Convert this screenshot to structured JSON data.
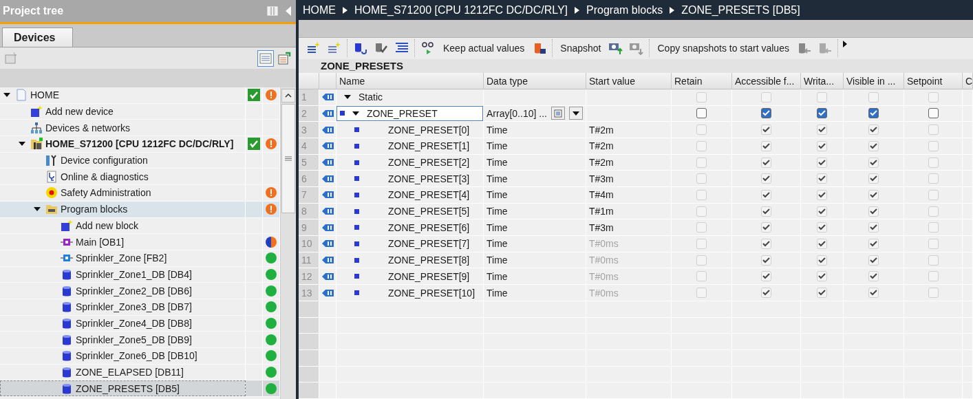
{
  "project_tree": {
    "title": "Project tree",
    "tabs": [
      {
        "label": "Devices",
        "selected": true
      }
    ],
    "items": [
      {
        "label": "HOME",
        "kind": "project",
        "expanded": true,
        "check": true,
        "status": {
          "kind": "warning"
        },
        "selected": false,
        "highlighted": false,
        "children": [
          {
            "label": "Add new device",
            "kind": "add-device",
            "check": false,
            "selected": false,
            "highlighted": false
          },
          {
            "label": "Devices & networks",
            "kind": "network",
            "check": false,
            "selected": false,
            "highlighted": false
          },
          {
            "label": "HOME_S71200 [CPU 1212FC DC/DC/RLY]",
            "kind": "plc",
            "expanded": true,
            "check": true,
            "status": {
              "kind": "warning"
            },
            "selected": false,
            "highlighted": false,
            "children": [
              {
                "label": "Device configuration",
                "kind": "device-config",
                "check": false,
                "selected": false,
                "highlighted": false
              },
              {
                "label": "Online & diagnostics",
                "kind": "diagnostics",
                "check": false,
                "selected": false,
                "highlighted": false
              },
              {
                "label": "Safety Administration",
                "kind": "safety",
                "check": false,
                "status": {
                  "kind": "warning"
                },
                "selected": false,
                "highlighted": false
              },
              {
                "label": "Program blocks",
                "kind": "folder",
                "expanded": true,
                "check": false,
                "status": {
                  "kind": "warning"
                },
                "selected": false,
                "highlighted": true,
                "children": [
                  {
                    "label": "Add new block",
                    "kind": "add-block",
                    "check": false,
                    "selected": false,
                    "highlighted": false
                  },
                  {
                    "label": "Main [OB1]",
                    "kind": "ob",
                    "check": false,
                    "status": {
                      "kind": "mixed"
                    },
                    "selected": false,
                    "highlighted": false
                  },
                  {
                    "label": "Sprinkler_Zone [FB2]",
                    "kind": "fb",
                    "check": false,
                    "status": {
                      "kind": "ok"
                    },
                    "selected": false,
                    "highlighted": false
                  },
                  {
                    "label": "Sprinkler_Zone1_DB [DB4]",
                    "kind": "db",
                    "check": false,
                    "status": {
                      "kind": "ok"
                    },
                    "selected": false,
                    "highlighted": false
                  },
                  {
                    "label": "Sprinkler_Zone2_DB [DB6]",
                    "kind": "db",
                    "check": false,
                    "status": {
                      "kind": "ok"
                    },
                    "selected": false,
                    "highlighted": false
                  },
                  {
                    "label": "Sprinkler_Zone3_DB [DB7]",
                    "kind": "db",
                    "check": false,
                    "status": {
                      "kind": "ok"
                    },
                    "selected": false,
                    "highlighted": false
                  },
                  {
                    "label": "Sprinkler_Zone4_DB [DB8]",
                    "kind": "db",
                    "check": false,
                    "status": {
                      "kind": "ok"
                    },
                    "selected": false,
                    "highlighted": false
                  },
                  {
                    "label": "Sprinkler_Zone5_DB [DB9]",
                    "kind": "db",
                    "check": false,
                    "status": {
                      "kind": "ok"
                    },
                    "selected": false,
                    "highlighted": false
                  },
                  {
                    "label": "Sprinkler_Zone6_DB [DB10]",
                    "kind": "db",
                    "check": false,
                    "status": {
                      "kind": "ok"
                    },
                    "selected": false,
                    "highlighted": false
                  },
                  {
                    "label": "ZONE_ELAPSED [DB11]",
                    "kind": "db",
                    "check": false,
                    "status": {
                      "kind": "ok"
                    },
                    "selected": false,
                    "highlighted": false
                  },
                  {
                    "label": "ZONE_PRESETS [DB5]",
                    "kind": "db",
                    "check": false,
                    "status": {
                      "kind": "ok"
                    },
                    "selected": true,
                    "highlighted": false
                  }
                ]
              }
            ]
          }
        ]
      }
    ]
  },
  "breadcrumb": [
    "HOME",
    "HOME_S71200 [CPU 1212FC DC/DC/RLY]",
    "Program blocks",
    "ZONE_PRESETS [DB5]"
  ],
  "toolbar": {
    "keep_label": "Keep actual values",
    "snapshot_label": "Snapshot",
    "copy_label": "Copy snapshots to start values"
  },
  "block_title": "ZONE_PRESETS",
  "table": {
    "columns": [
      "Name",
      "Data type",
      "Start value",
      "Retain",
      "Accessible f...",
      "Writa...",
      "Visible in ...",
      "Setpoint",
      "C"
    ],
    "rows": [
      {
        "num": "1",
        "kind": "section",
        "name": "Static",
        "expanded": true,
        "data_type": "",
        "start_value": "",
        "default": false,
        "selected": false,
        "flags": [
          {
            "checked": false,
            "disabled": true
          },
          {
            "checked": false,
            "disabled": true
          },
          {
            "checked": false,
            "disabled": true
          },
          {
            "checked": false,
            "disabled": true
          },
          {
            "checked": false,
            "disabled": true
          }
        ]
      },
      {
        "num": "2",
        "kind": "array",
        "name": "ZONE_PRESET",
        "expanded": true,
        "data_type": "Array[0..10] ...",
        "start_value": "",
        "default": false,
        "selected": true,
        "flags": [
          {
            "checked": false,
            "disabled": false
          },
          {
            "checked": true,
            "disabled": false
          },
          {
            "checked": true,
            "disabled": false
          },
          {
            "checked": true,
            "disabled": false
          },
          {
            "checked": false,
            "disabled": false
          }
        ]
      },
      {
        "num": "3",
        "kind": "element",
        "name": "ZONE_PRESET[0]",
        "data_type": "Time",
        "start_value": "T#2m",
        "default": false,
        "selected": false,
        "flags": [
          {
            "checked": false,
            "disabled": true
          },
          {
            "checked": true,
            "disabled": true
          },
          {
            "checked": true,
            "disabled": true
          },
          {
            "checked": true,
            "disabled": true
          },
          {
            "checked": false,
            "disabled": true
          }
        ]
      },
      {
        "num": "4",
        "kind": "element",
        "name": "ZONE_PRESET[1]",
        "data_type": "Time",
        "start_value": "T#2m",
        "default": false,
        "selected": false,
        "flags": [
          {
            "checked": false,
            "disabled": true
          },
          {
            "checked": true,
            "disabled": true
          },
          {
            "checked": true,
            "disabled": true
          },
          {
            "checked": true,
            "disabled": true
          },
          {
            "checked": false,
            "disabled": true
          }
        ]
      },
      {
        "num": "5",
        "kind": "element",
        "name": "ZONE_PRESET[2]",
        "data_type": "Time",
        "start_value": "T#2m",
        "default": false,
        "selected": false,
        "flags": [
          {
            "checked": false,
            "disabled": true
          },
          {
            "checked": true,
            "disabled": true
          },
          {
            "checked": true,
            "disabled": true
          },
          {
            "checked": true,
            "disabled": true
          },
          {
            "checked": false,
            "disabled": true
          }
        ]
      },
      {
        "num": "6",
        "kind": "element",
        "name": "ZONE_PRESET[3]",
        "data_type": "Time",
        "start_value": "T#3m",
        "default": false,
        "selected": false,
        "flags": [
          {
            "checked": false,
            "disabled": true
          },
          {
            "checked": true,
            "disabled": true
          },
          {
            "checked": true,
            "disabled": true
          },
          {
            "checked": true,
            "disabled": true
          },
          {
            "checked": false,
            "disabled": true
          }
        ]
      },
      {
        "num": "7",
        "kind": "element",
        "name": "ZONE_PRESET[4]",
        "data_type": "Time",
        "start_value": "T#4m",
        "default": false,
        "selected": false,
        "flags": [
          {
            "checked": false,
            "disabled": true
          },
          {
            "checked": true,
            "disabled": true
          },
          {
            "checked": true,
            "disabled": true
          },
          {
            "checked": true,
            "disabled": true
          },
          {
            "checked": false,
            "disabled": true
          }
        ]
      },
      {
        "num": "8",
        "kind": "element",
        "name": "ZONE_PRESET[5]",
        "data_type": "Time",
        "start_value": "T#1m",
        "default": false,
        "selected": false,
        "flags": [
          {
            "checked": false,
            "disabled": true
          },
          {
            "checked": true,
            "disabled": true
          },
          {
            "checked": true,
            "disabled": true
          },
          {
            "checked": true,
            "disabled": true
          },
          {
            "checked": false,
            "disabled": true
          }
        ]
      },
      {
        "num": "9",
        "kind": "element",
        "name": "ZONE_PRESET[6]",
        "data_type": "Time",
        "start_value": "T#3m",
        "default": false,
        "selected": false,
        "flags": [
          {
            "checked": false,
            "disabled": true
          },
          {
            "checked": true,
            "disabled": true
          },
          {
            "checked": true,
            "disabled": true
          },
          {
            "checked": true,
            "disabled": true
          },
          {
            "checked": false,
            "disabled": true
          }
        ]
      },
      {
        "num": "10",
        "kind": "element",
        "name": "ZONE_PRESET[7]",
        "data_type": "Time",
        "start_value": "T#0ms",
        "default": true,
        "selected": false,
        "flags": [
          {
            "checked": false,
            "disabled": true
          },
          {
            "checked": true,
            "disabled": true
          },
          {
            "checked": true,
            "disabled": true
          },
          {
            "checked": true,
            "disabled": true
          },
          {
            "checked": false,
            "disabled": true
          }
        ]
      },
      {
        "num": "11",
        "kind": "element",
        "name": "ZONE_PRESET[8]",
        "data_type": "Time",
        "start_value": "T#0ms",
        "default": true,
        "selected": false,
        "flags": [
          {
            "checked": false,
            "disabled": true
          },
          {
            "checked": true,
            "disabled": true
          },
          {
            "checked": true,
            "disabled": true
          },
          {
            "checked": true,
            "disabled": true
          },
          {
            "checked": false,
            "disabled": true
          }
        ]
      },
      {
        "num": "12",
        "kind": "element",
        "name": "ZONE_PRESET[9]",
        "data_type": "Time",
        "start_value": "T#0ms",
        "default": true,
        "selected": false,
        "flags": [
          {
            "checked": false,
            "disabled": true
          },
          {
            "checked": true,
            "disabled": true
          },
          {
            "checked": true,
            "disabled": true
          },
          {
            "checked": true,
            "disabled": true
          },
          {
            "checked": false,
            "disabled": true
          }
        ]
      },
      {
        "num": "13",
        "kind": "element",
        "name": "ZONE_PRESET[10]",
        "data_type": "Time",
        "start_value": "T#0ms",
        "default": true,
        "selected": false,
        "flags": [
          {
            "checked": false,
            "disabled": true
          },
          {
            "checked": true,
            "disabled": true
          },
          {
            "checked": true,
            "disabled": true
          },
          {
            "checked": true,
            "disabled": true
          },
          {
            "checked": false,
            "disabled": true
          }
        ]
      }
    ]
  }
}
